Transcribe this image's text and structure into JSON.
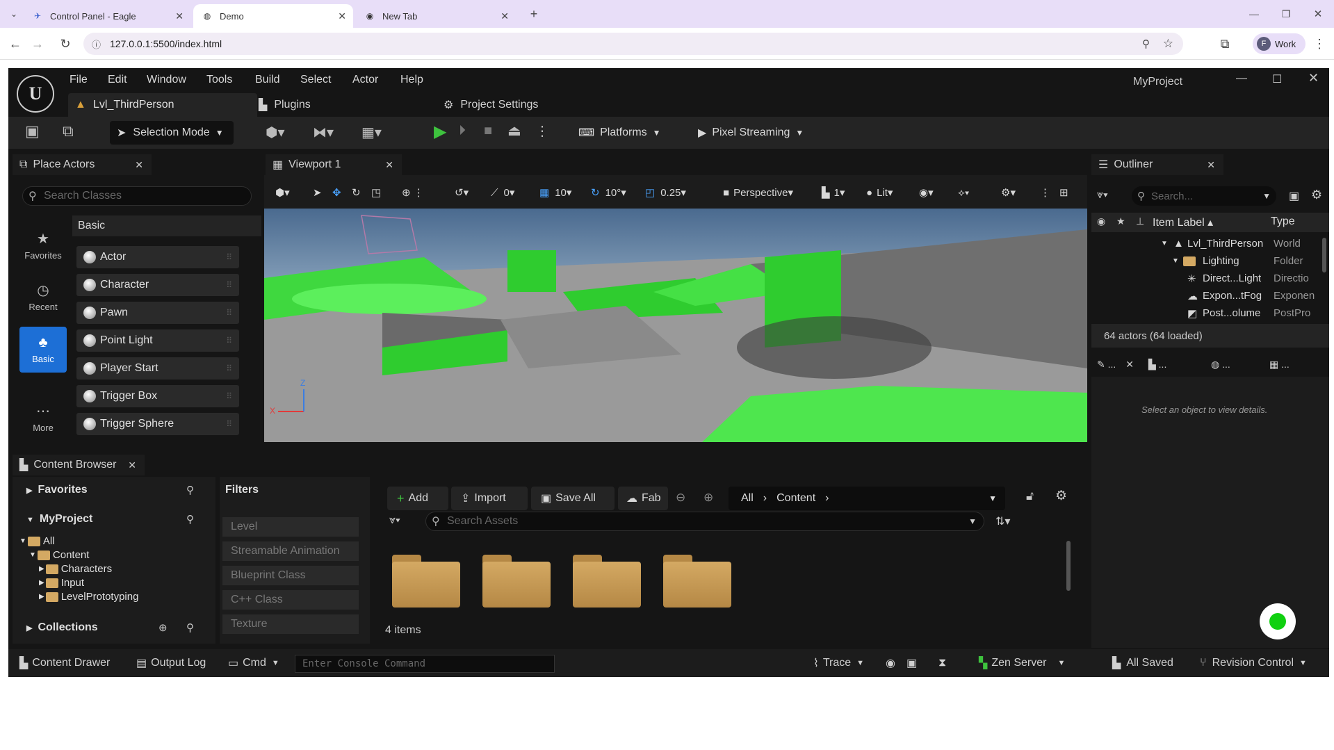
{
  "browser": {
    "tabs": [
      {
        "label": "Control Panel - Eagle",
        "icon": "eagle-icon"
      },
      {
        "label": "Demo",
        "icon": "globe-icon"
      },
      {
        "label": "New Tab",
        "icon": "chrome-icon"
      }
    ],
    "url": "127.0.0.1:5500/index.html",
    "profile": {
      "initial": "F",
      "label": "Work"
    }
  },
  "editor": {
    "menu": [
      "File",
      "Edit",
      "Window",
      "Tools",
      "Build",
      "Select",
      "Actor",
      "Help"
    ],
    "project_name": "MyProject",
    "doc_tabs": {
      "level": "Lvl_ThirdPerson",
      "plugins": "Plugins",
      "settings": "Project Settings"
    },
    "toolbar": {
      "selection_mode": "Selection Mode",
      "platforms": "Platforms",
      "pixel_streaming": "Pixel Streaming"
    },
    "place_actors": {
      "title": "Place Actors",
      "search_placeholder": "Search Classes",
      "category_header": "Basic",
      "categories": [
        {
          "label": "Favorites",
          "icon": "star-icon"
        },
        {
          "label": "Recent",
          "icon": "clock-icon"
        },
        {
          "label": "Basic",
          "icon": "shapes-icon"
        },
        {
          "label": "More",
          "icon": "more-icon"
        }
      ],
      "items": [
        "Actor",
        "Character",
        "Pawn",
        "Point Light",
        "Player Start",
        "Trigger Box",
        "Trigger Sphere"
      ]
    },
    "viewport": {
      "title": "Viewport 1",
      "rotation_snap": "0",
      "grid_snap": "10",
      "angle_snap": "10°",
      "scale_snap": "0.25",
      "view_mode": "Perspective",
      "camera_speed": "1",
      "lighting": "Lit",
      "axis": {
        "z": "Z",
        "x": "X"
      }
    },
    "outliner": {
      "title": "Outliner",
      "search_placeholder": "Search...",
      "columns": {
        "label": "Item Label",
        "type": "Type"
      },
      "rows": [
        {
          "label": "Lvl_ThirdPerson",
          "type": "World"
        },
        {
          "label": "Lighting",
          "type": "Folder"
        },
        {
          "label": "Direct...Light",
          "type": "Directio"
        },
        {
          "label": "Expon...tFog",
          "type": "Exponen"
        },
        {
          "label": "Post...olume",
          "type": "PostPro"
        }
      ],
      "count": "64 actors (64 loaded)"
    },
    "details": {
      "tabs": [
        "...",
        "...",
        "...",
        "..."
      ],
      "empty_message": "Select an object to view details."
    },
    "content_browser": {
      "title": "Content Browser",
      "favorites": "Favorites",
      "project": "MyProject",
      "tree": [
        "All",
        "Content",
        "Characters",
        "Input",
        "LevelPrototyping"
      ],
      "collections": "Collections",
      "filters_title": "Filters",
      "filters": [
        "Level",
        "Streamable Animation",
        "Blueprint Class",
        "C++ Class",
        "Texture"
      ],
      "buttons": {
        "add": "Add",
        "import": "Import",
        "save_all": "Save All",
        "fab": "Fab"
      },
      "path": [
        "All",
        "Content"
      ],
      "search_placeholder": "Search Assets",
      "item_count": "4 items"
    },
    "status_bar": {
      "content_drawer": "Content Drawer",
      "output_log": "Output Log",
      "cmd": "Cmd",
      "console_placeholder": "Enter Console Command",
      "trace": "Trace",
      "zen_server": "Zen Server",
      "all_saved": "All Saved",
      "revision_control": "Revision Control"
    }
  }
}
